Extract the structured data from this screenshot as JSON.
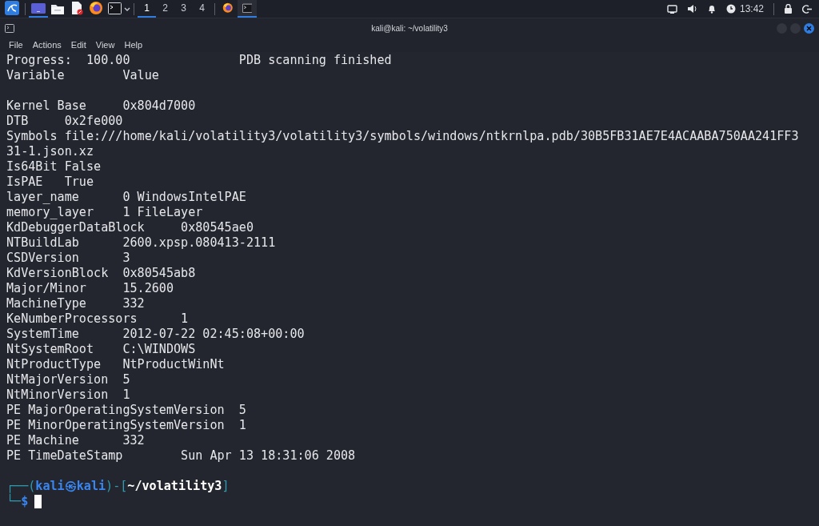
{
  "taskbar": {
    "launchers": [
      {
        "kind": "menu",
        "selected": false
      },
      {
        "kind": "desktop",
        "selected": true
      },
      {
        "kind": "files",
        "selected": false
      },
      {
        "kind": "editor",
        "selected": false
      },
      {
        "kind": "browser",
        "selected": false
      },
      {
        "kind": "terminal",
        "selected": false
      }
    ],
    "workspaces": [
      {
        "label": "1",
        "selected": true
      },
      {
        "label": "2",
        "selected": false
      },
      {
        "label": "3",
        "selected": false
      },
      {
        "label": "4",
        "selected": false
      }
    ],
    "tasks": [
      {
        "kind": "browser",
        "selected": false
      },
      {
        "kind": "terminal",
        "selected": true
      }
    ],
    "clock": "13:42"
  },
  "window": {
    "title": "kali@kali: ~/volatility3"
  },
  "menu": [
    "File",
    "Actions",
    "Edit",
    "View",
    "Help"
  ],
  "terminal": {
    "lines": [
      "Progress:  100.00               PDB scanning finished",
      "Variable        Value",
      {
        "kind": "blank"
      },
      "Kernel Base     0x804d7000",
      "DTB     0x2fe000",
      "Symbols file:///home/kali/volatility3/volatility3/symbols/windows/ntkrnlpa.pdb/30B5FB31AE7E4ACAABA750AA241FF3",
      "31-1.json.xz",
      "Is64Bit False",
      "IsPAE   True",
      "layer_name      0 WindowsIntelPAE",
      "memory_layer    1 FileLayer",
      "KdDebuggerDataBlock     0x80545ae0",
      "NTBuildLab      2600.xpsp.080413-2111",
      "CSDVersion      3",
      "KdVersionBlock  0x80545ab8",
      "Major/Minor     15.2600",
      "MachineType     332",
      "KeNumberProcessors      1",
      "SystemTime      2012-07-22 02:45:08+00:00",
      "NtSystemRoot    C:\\WINDOWS",
      "NtProductType   NtProductWinNt",
      "NtMajorVersion  5",
      "NtMinorVersion  1",
      "PE MajorOperatingSystemVersion  5",
      "PE MinorOperatingSystemVersion  1",
      "PE Machine      332",
      "PE TimeDateStamp        Sun Apr 13 18:31:06 2008",
      {
        "kind": "blank"
      }
    ],
    "prompt": [
      [
        {
          "kind": "frame",
          "text": "┌──("
        },
        {
          "kind": "user",
          "text": "kali㉿kali"
        },
        {
          "kind": "frame",
          "text": ")-["
        },
        {
          "kind": "path",
          "text": "~/volatility3"
        },
        {
          "kind": "frame",
          "text": "]"
        }
      ],
      [
        {
          "kind": "frame",
          "text": "└─"
        },
        {
          "kind": "dollar",
          "text": "$"
        }
      ]
    ]
  }
}
